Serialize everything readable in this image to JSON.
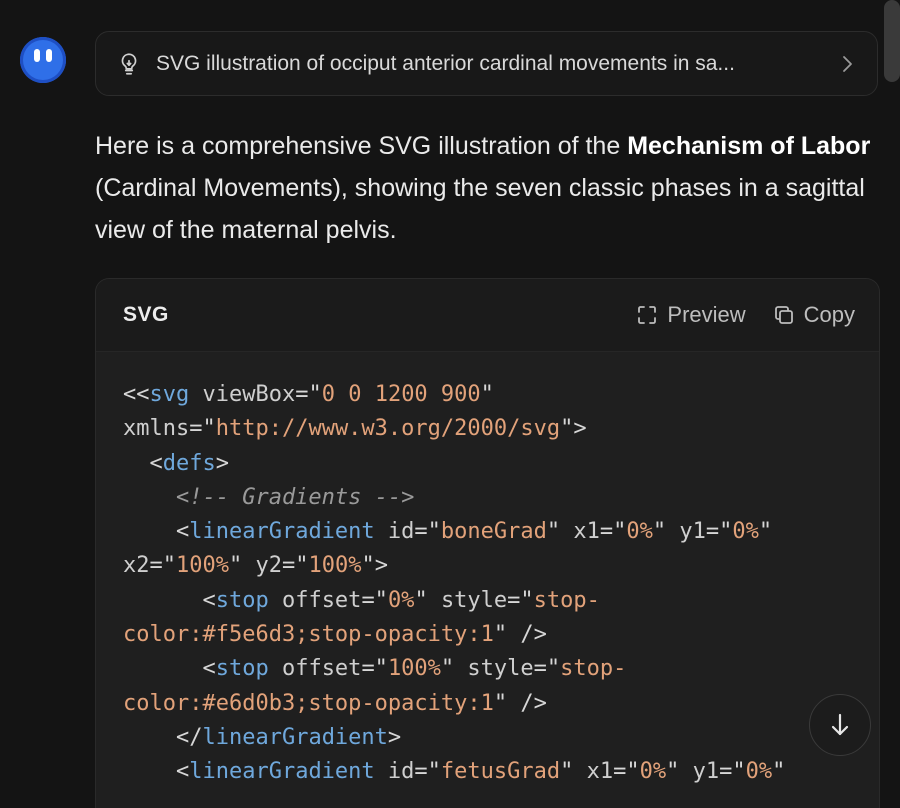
{
  "thought": {
    "summary": "SVG illustration of occiput anterior cardinal movements in sa..."
  },
  "message": {
    "part1": "Here is a comprehensive SVG illustration of the ",
    "bold": "Mechanism of Labor",
    "part2": " (Cardinal Movements), showing the seven classic phases in a sagittal view of the maternal pelvis."
  },
  "code_block": {
    "language": "SVG",
    "preview_label": "Preview",
    "copy_label": "Copy",
    "lines": [
      [
        [
          "p",
          "<<"
        ],
        [
          "t",
          "svg"
        ],
        [
          "p",
          " "
        ],
        [
          "a",
          "viewBox"
        ],
        [
          "p",
          "=\""
        ],
        [
          "s",
          "0 0 1200 900"
        ],
        [
          "p",
          "\""
        ]
      ],
      [
        [
          "a",
          "xmlns"
        ],
        [
          "p",
          "=\""
        ],
        [
          "s",
          "http://www.w3.org/2000/svg"
        ],
        [
          "p",
          "\">"
        ]
      ],
      [
        [
          "p",
          "  <"
        ],
        [
          "t",
          "defs"
        ],
        [
          "p",
          ">"
        ]
      ],
      [
        [
          "c",
          "    <!-- Gradients -->"
        ]
      ],
      [
        [
          "p",
          "    <"
        ],
        [
          "t",
          "linearGradient"
        ],
        [
          "p",
          " "
        ],
        [
          "a",
          "id"
        ],
        [
          "p",
          "=\""
        ],
        [
          "s",
          "boneGrad"
        ],
        [
          "p",
          "\" "
        ],
        [
          "a",
          "x1"
        ],
        [
          "p",
          "=\""
        ],
        [
          "s",
          "0%"
        ],
        [
          "p",
          "\" "
        ],
        [
          "a",
          "y1"
        ],
        [
          "p",
          "=\""
        ],
        [
          "s",
          "0%"
        ],
        [
          "p",
          "\""
        ]
      ],
      [
        [
          "a",
          "x2"
        ],
        [
          "p",
          "=\""
        ],
        [
          "s",
          "100%"
        ],
        [
          "p",
          "\" "
        ],
        [
          "a",
          "y2"
        ],
        [
          "p",
          "=\""
        ],
        [
          "s",
          "100%"
        ],
        [
          "p",
          "\">"
        ]
      ],
      [
        [
          "p",
          "      <"
        ],
        [
          "t",
          "stop"
        ],
        [
          "p",
          " "
        ],
        [
          "a",
          "offset"
        ],
        [
          "p",
          "=\""
        ],
        [
          "s",
          "0%"
        ],
        [
          "p",
          "\" "
        ],
        [
          "a",
          "style"
        ],
        [
          "p",
          "=\""
        ],
        [
          "s",
          "stop-"
        ]
      ],
      [
        [
          "s",
          "color:#f5e6d3;stop-opacity:"
        ],
        [
          "n",
          "1"
        ],
        [
          "p",
          "\" />"
        ]
      ],
      [
        [
          "p",
          "      <"
        ],
        [
          "t",
          "stop"
        ],
        [
          "p",
          " "
        ],
        [
          "a",
          "offset"
        ],
        [
          "p",
          "=\""
        ],
        [
          "s",
          "100%"
        ],
        [
          "p",
          "\" "
        ],
        [
          "a",
          "style"
        ],
        [
          "p",
          "=\""
        ],
        [
          "s",
          "stop-"
        ]
      ],
      [
        [
          "s",
          "color:#e6d0b3;stop-opacity:"
        ],
        [
          "n",
          "1"
        ],
        [
          "p",
          "\" />"
        ]
      ],
      [
        [
          "p",
          "    </"
        ],
        [
          "t",
          "linearGradient"
        ],
        [
          "p",
          ">"
        ]
      ],
      [
        [
          "p",
          "    <"
        ],
        [
          "t",
          "linearGradient"
        ],
        [
          "p",
          " "
        ],
        [
          "a",
          "id"
        ],
        [
          "p",
          "=\""
        ],
        [
          "s",
          "fetusGrad"
        ],
        [
          "p",
          "\" "
        ],
        [
          "a",
          "x1"
        ],
        [
          "p",
          "=\""
        ],
        [
          "s",
          "0%"
        ],
        [
          "p",
          "\" "
        ],
        [
          "a",
          "y1"
        ],
        [
          "p",
          "=\""
        ],
        [
          "s",
          "0%"
        ],
        [
          "p",
          "\""
        ]
      ]
    ]
  },
  "icons": {
    "thought": "lightbulb-icon",
    "expand": "chevron-right-icon",
    "preview": "preview-frame-icon",
    "copy": "copy-icon",
    "scroll": "arrow-down-icon"
  },
  "colors": {
    "background": "#141414",
    "avatar": "#2f6fe8",
    "tag": "#6fa8dc",
    "string": "#e2a27a"
  }
}
